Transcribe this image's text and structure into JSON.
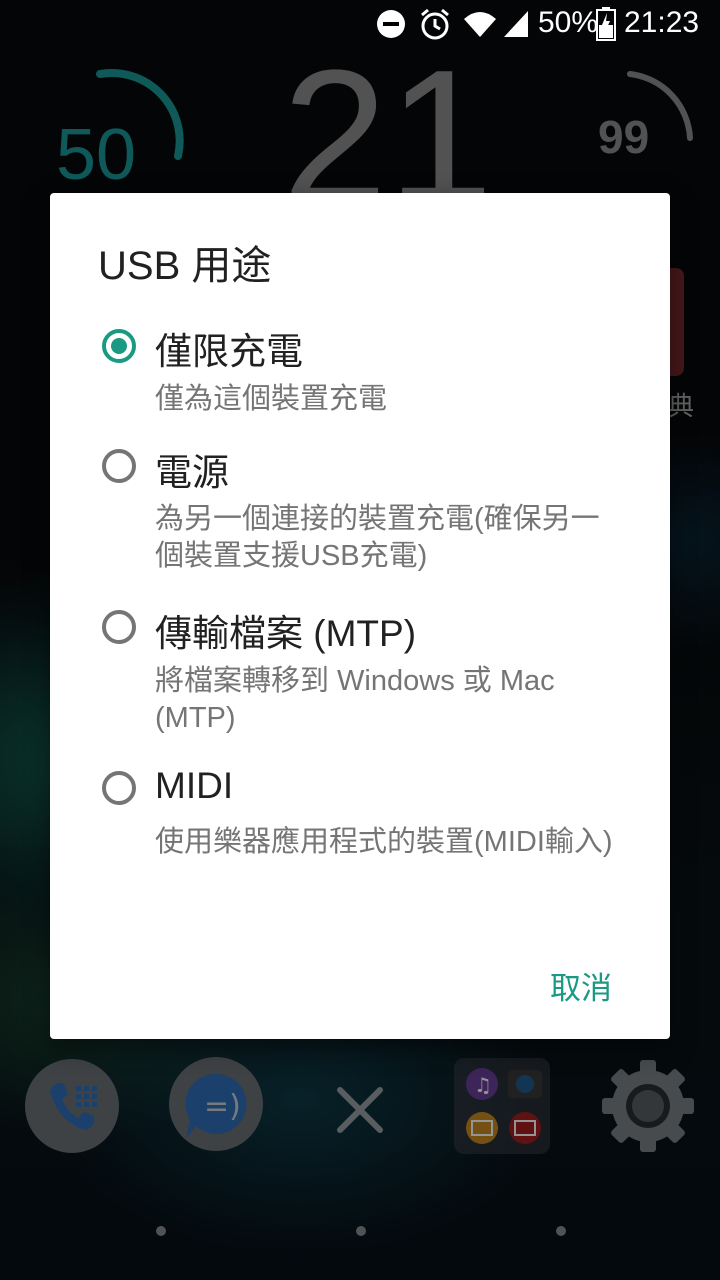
{
  "status_bar": {
    "battery_percent": "50%",
    "time": "21:23"
  },
  "clock_widget": {
    "left_value": "50",
    "hour": "21",
    "right_value": "99"
  },
  "dialog": {
    "title": "USB 用途",
    "options": [
      {
        "label": "僅限充電",
        "description": "僅為這個裝置充電",
        "selected": true
      },
      {
        "label": "電源",
        "description": "為另一個連接的裝置充電(確保另一個裝置支援USB充電)",
        "selected": false
      },
      {
        "label": "傳輸檔案 (MTP)",
        "description": "將檔案轉移到 Windows 或 Mac (MTP)",
        "selected": false
      },
      {
        "label": "MIDI",
        "description": "使用樂器應用程式的裝置(MIDI輸入)",
        "selected": false
      }
    ],
    "cancel_label": "取消"
  },
  "colors": {
    "accent": "#1a9a83",
    "widget_teal": "#1fa0a0"
  },
  "dock": {
    "icons": [
      "phone-icon",
      "messages-icon",
      "x-icon",
      "media-folder-icon",
      "settings-gear-icon"
    ]
  },
  "partial_text_right": "典"
}
